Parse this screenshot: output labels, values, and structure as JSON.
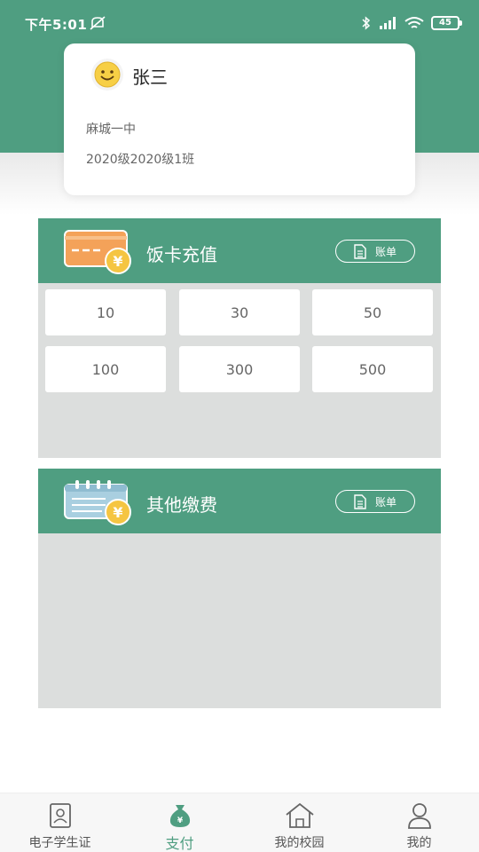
{
  "status_bar": {
    "time": "下午5:01",
    "battery": "45"
  },
  "profile": {
    "name": "张三",
    "school": "麻城一中",
    "class": "2020级2020级1班",
    "avatar_icon": "smiley-face-icon"
  },
  "recharge": {
    "title": "饭卡充值",
    "bill_label": "账单",
    "icon": "card-yuan-icon",
    "amounts": [
      "10",
      "30",
      "50",
      "100",
      "300",
      "500"
    ]
  },
  "other_fees": {
    "title": "其他缴费",
    "bill_label": "账单",
    "icon": "calendar-yuan-icon"
  },
  "tabs": [
    {
      "label": "电子学生证",
      "icon": "id-card-icon"
    },
    {
      "label": "支付",
      "icon": "money-bag-icon",
      "active": true
    },
    {
      "label": "我的校园",
      "icon": "house-icon"
    },
    {
      "label": "我的",
      "icon": "person-icon"
    }
  ],
  "colors": {
    "primary": "#4f9e81",
    "panel_bg": "#dcdedd",
    "coin": "#f5c542",
    "card": "#f4a259"
  }
}
